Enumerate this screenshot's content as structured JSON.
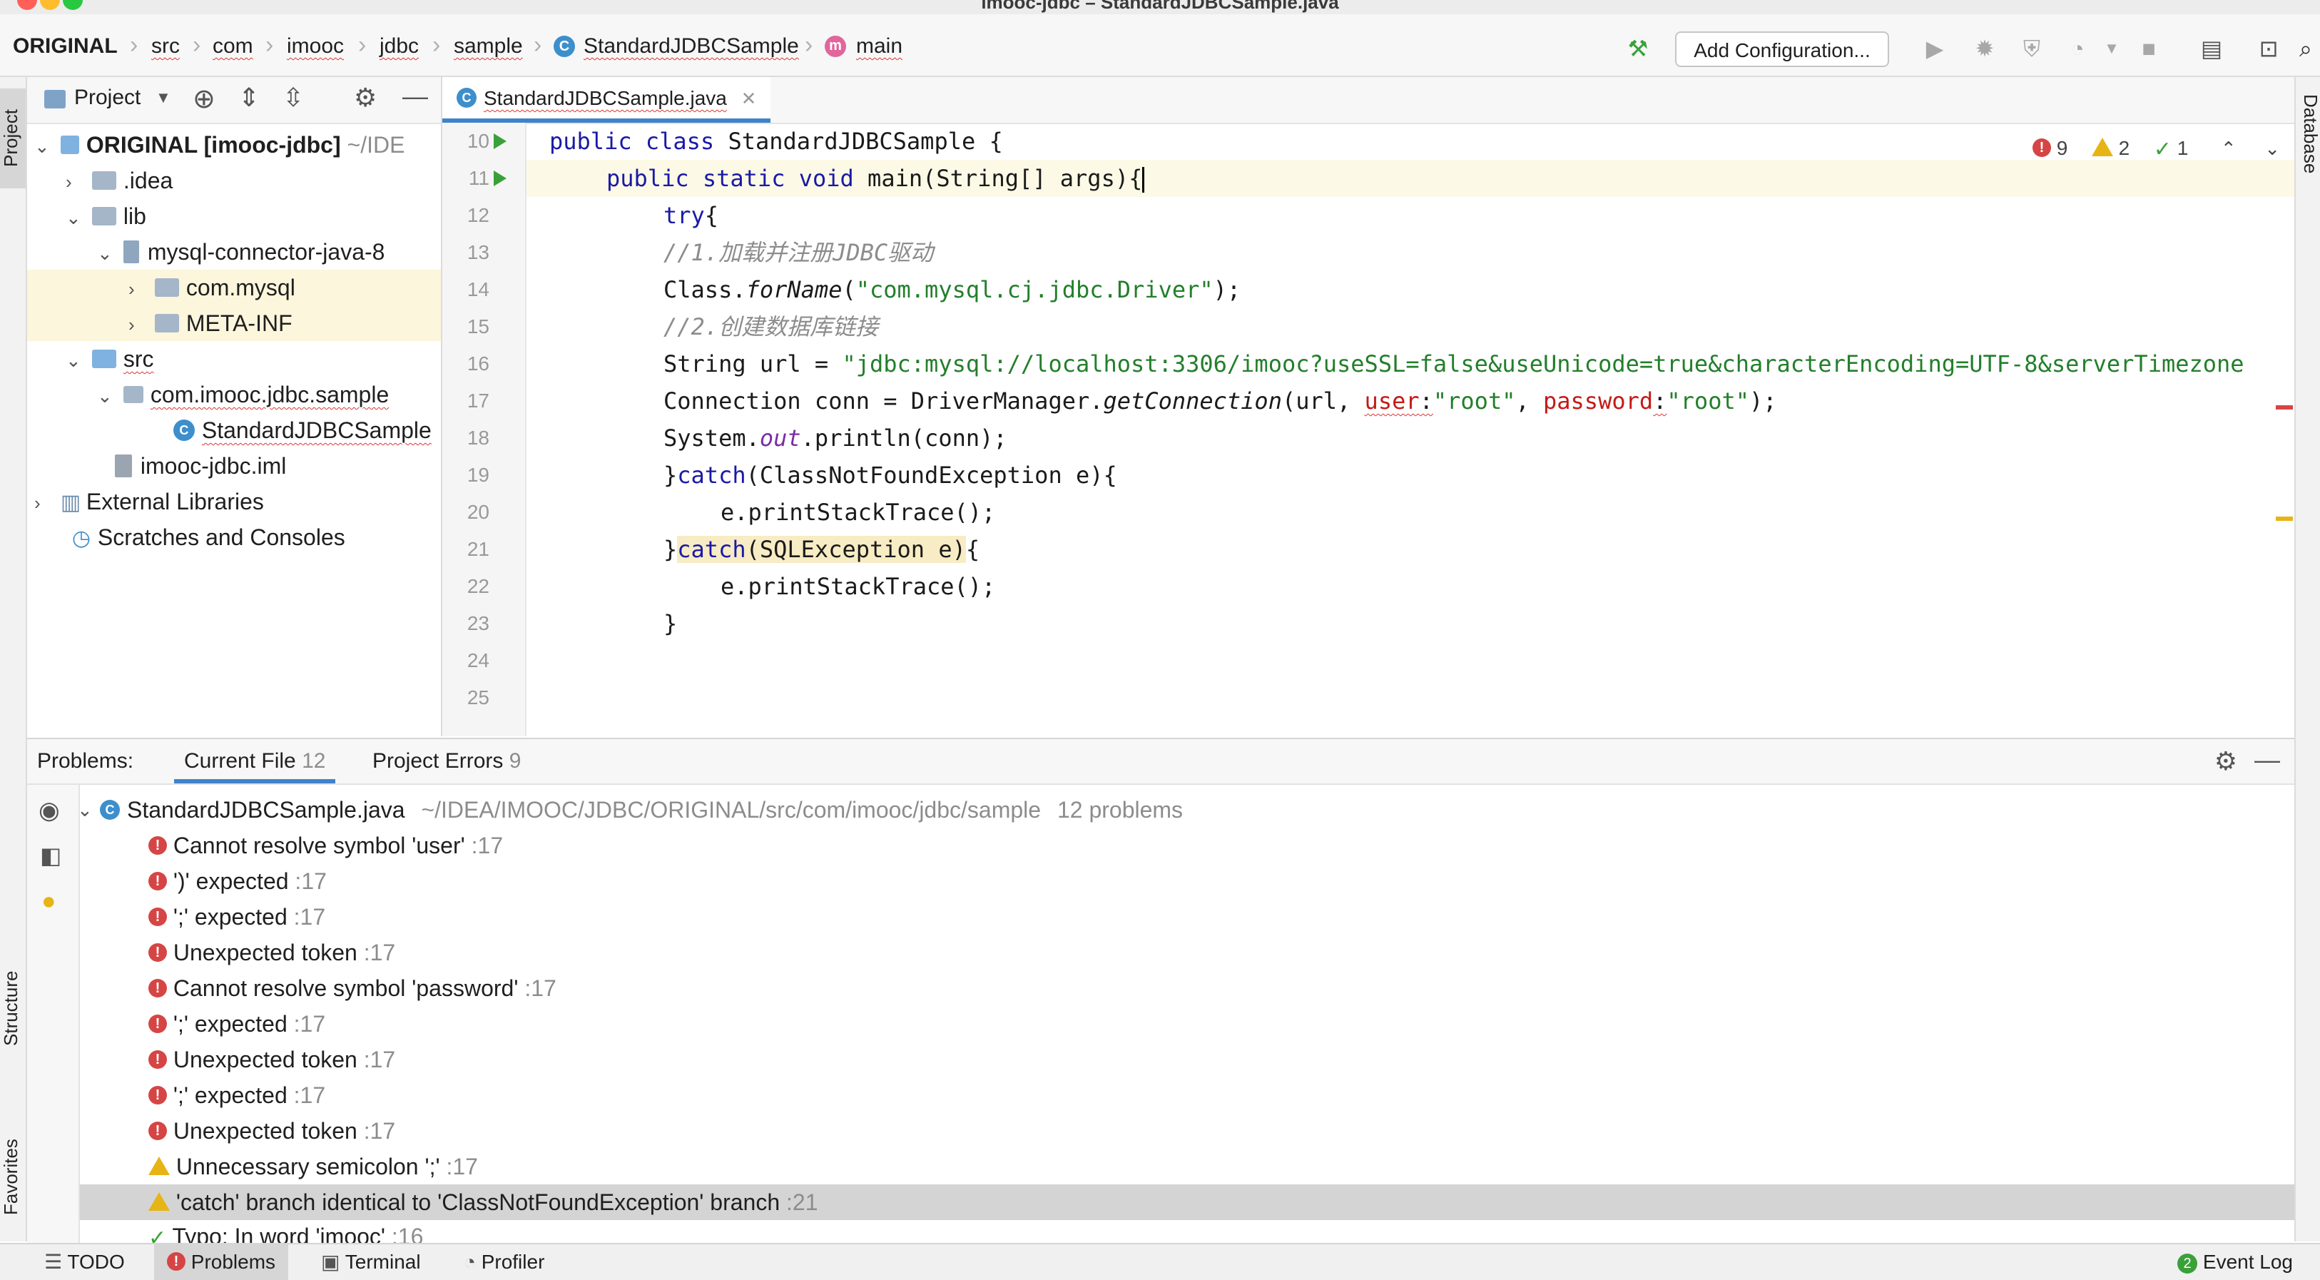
{
  "window": {
    "title": "imooc-jdbc – StandardJDBCSample.java"
  },
  "navbar": {
    "breadcrumbs": [
      "ORIGINAL",
      "src",
      "com",
      "imooc",
      "jdbc",
      "sample",
      "StandardJDBCSample",
      "main"
    ],
    "add_config_label": "Add Configuration..."
  },
  "left_stripe": {
    "project": "Project",
    "structure": "Structure",
    "favorites": "Favorites"
  },
  "right_stripe": {
    "database": "Database"
  },
  "project_panel": {
    "title": "Project",
    "tree": [
      {
        "label": "ORIGINAL [imooc-jdbc]",
        "suffix": "~/IDE"
      },
      {
        "label": ".idea"
      },
      {
        "label": "lib"
      },
      {
        "label": "mysql-connector-java-8"
      },
      {
        "label": "com.mysql"
      },
      {
        "label": "META-INF"
      },
      {
        "label": "src"
      },
      {
        "label": "com.imooc.jdbc.sample"
      },
      {
        "label": "StandardJDBCSample"
      },
      {
        "label": "imooc-jdbc.iml"
      },
      {
        "label": "External Libraries"
      },
      {
        "label": "Scratches and Consoles"
      }
    ]
  },
  "editor": {
    "tab": "StandardJDBCSample.java",
    "inspection": {
      "errors": "9",
      "warnings": "2",
      "typos": "1"
    },
    "line_numbers": [
      "10",
      "11",
      "12",
      "13",
      "14",
      "15",
      "16",
      "17",
      "18",
      "19",
      "20",
      "21",
      "22",
      "23",
      "24",
      "25"
    ],
    "code": {
      "l10a": "public class ",
      "l10b": "StandardJDBCSample {",
      "l11a": "public static void ",
      "l11b": "main(String[] args){",
      "l12a": "try",
      "l12b": "{",
      "l13": "//1.加载并注册JDBC驱动",
      "l14a": "Class.",
      "l14b": "forName",
      "l14c": "(",
      "l14d": "\"com.mysql.cj.jdbc.Driver\"",
      "l14e": ");",
      "l15": "//2.创建数据库链接",
      "l16a": "String url = ",
      "l16b": "\"jdbc:mysql://localhost:3306/imooc?useSSL=false&useUnicode=true&characterEncoding=UTF-8&serverTimezone",
      "l17a": "Connection conn = DriverManager.",
      "l17b": "getConnection",
      "l17c": "(url, ",
      "l17d": "user",
      "l17e": ":",
      "l17f": "\"root\"",
      "l17g": ", ",
      "l17h": "password",
      "l17i": ":",
      "l17j": "\"root\"",
      "l17k": ");",
      "l18a": "System.",
      "l18b": "out",
      "l18c": ".println(conn);",
      "l19a": "}",
      "l19b": "catch",
      "l19c": "(ClassNotFoundException e){",
      "l20": "e.printStackTrace();",
      "l21a": "}",
      "l21b": "catch",
      "l21c": "(SQLException e)",
      "l21d": "{",
      "l22": "e.printStackTrace();",
      "l23": "}"
    }
  },
  "problems": {
    "label": "Problems:",
    "tab_current": "Current File",
    "tab_current_count": "12",
    "tab_project": "Project Errors",
    "tab_project_count": "9",
    "file": {
      "name": "StandardJDBCSample.java",
      "path": "~/IDEA/IMOOC/JDBC/ORIGINAL/src/com/imooc/jdbc/sample",
      "count": "12 problems"
    },
    "items": [
      {
        "text": "Cannot resolve symbol 'user'",
        "line": ":17"
      },
      {
        "text": "')' expected",
        "line": ":17"
      },
      {
        "text": "';' expected",
        "line": ":17"
      },
      {
        "text": "Unexpected token",
        "line": ":17"
      },
      {
        "text": "Cannot resolve symbol 'password'",
        "line": ":17"
      },
      {
        "text": "';' expected",
        "line": ":17"
      },
      {
        "text": "Unexpected token",
        "line": ":17"
      },
      {
        "text": "';' expected",
        "line": ":17"
      },
      {
        "text": "Unexpected token",
        "line": ":17"
      },
      {
        "text": "Unnecessary semicolon ';'",
        "line": ":17"
      },
      {
        "text": "'catch' branch identical to 'ClassNotFoundException' branch",
        "line": ":21"
      },
      {
        "text": "Typo: In word 'imooc'",
        "line": ":16"
      }
    ]
  },
  "bottom_bar": {
    "todo": "TODO",
    "problems": "Problems",
    "terminal": "Terminal",
    "profiler": "Profiler",
    "event_log": "Event Log",
    "event_count": "2"
  },
  "colors": {
    "accent": "#4083c9",
    "error": "#d64545",
    "warning": "#e7b416",
    "ok": "#3aa13a"
  }
}
